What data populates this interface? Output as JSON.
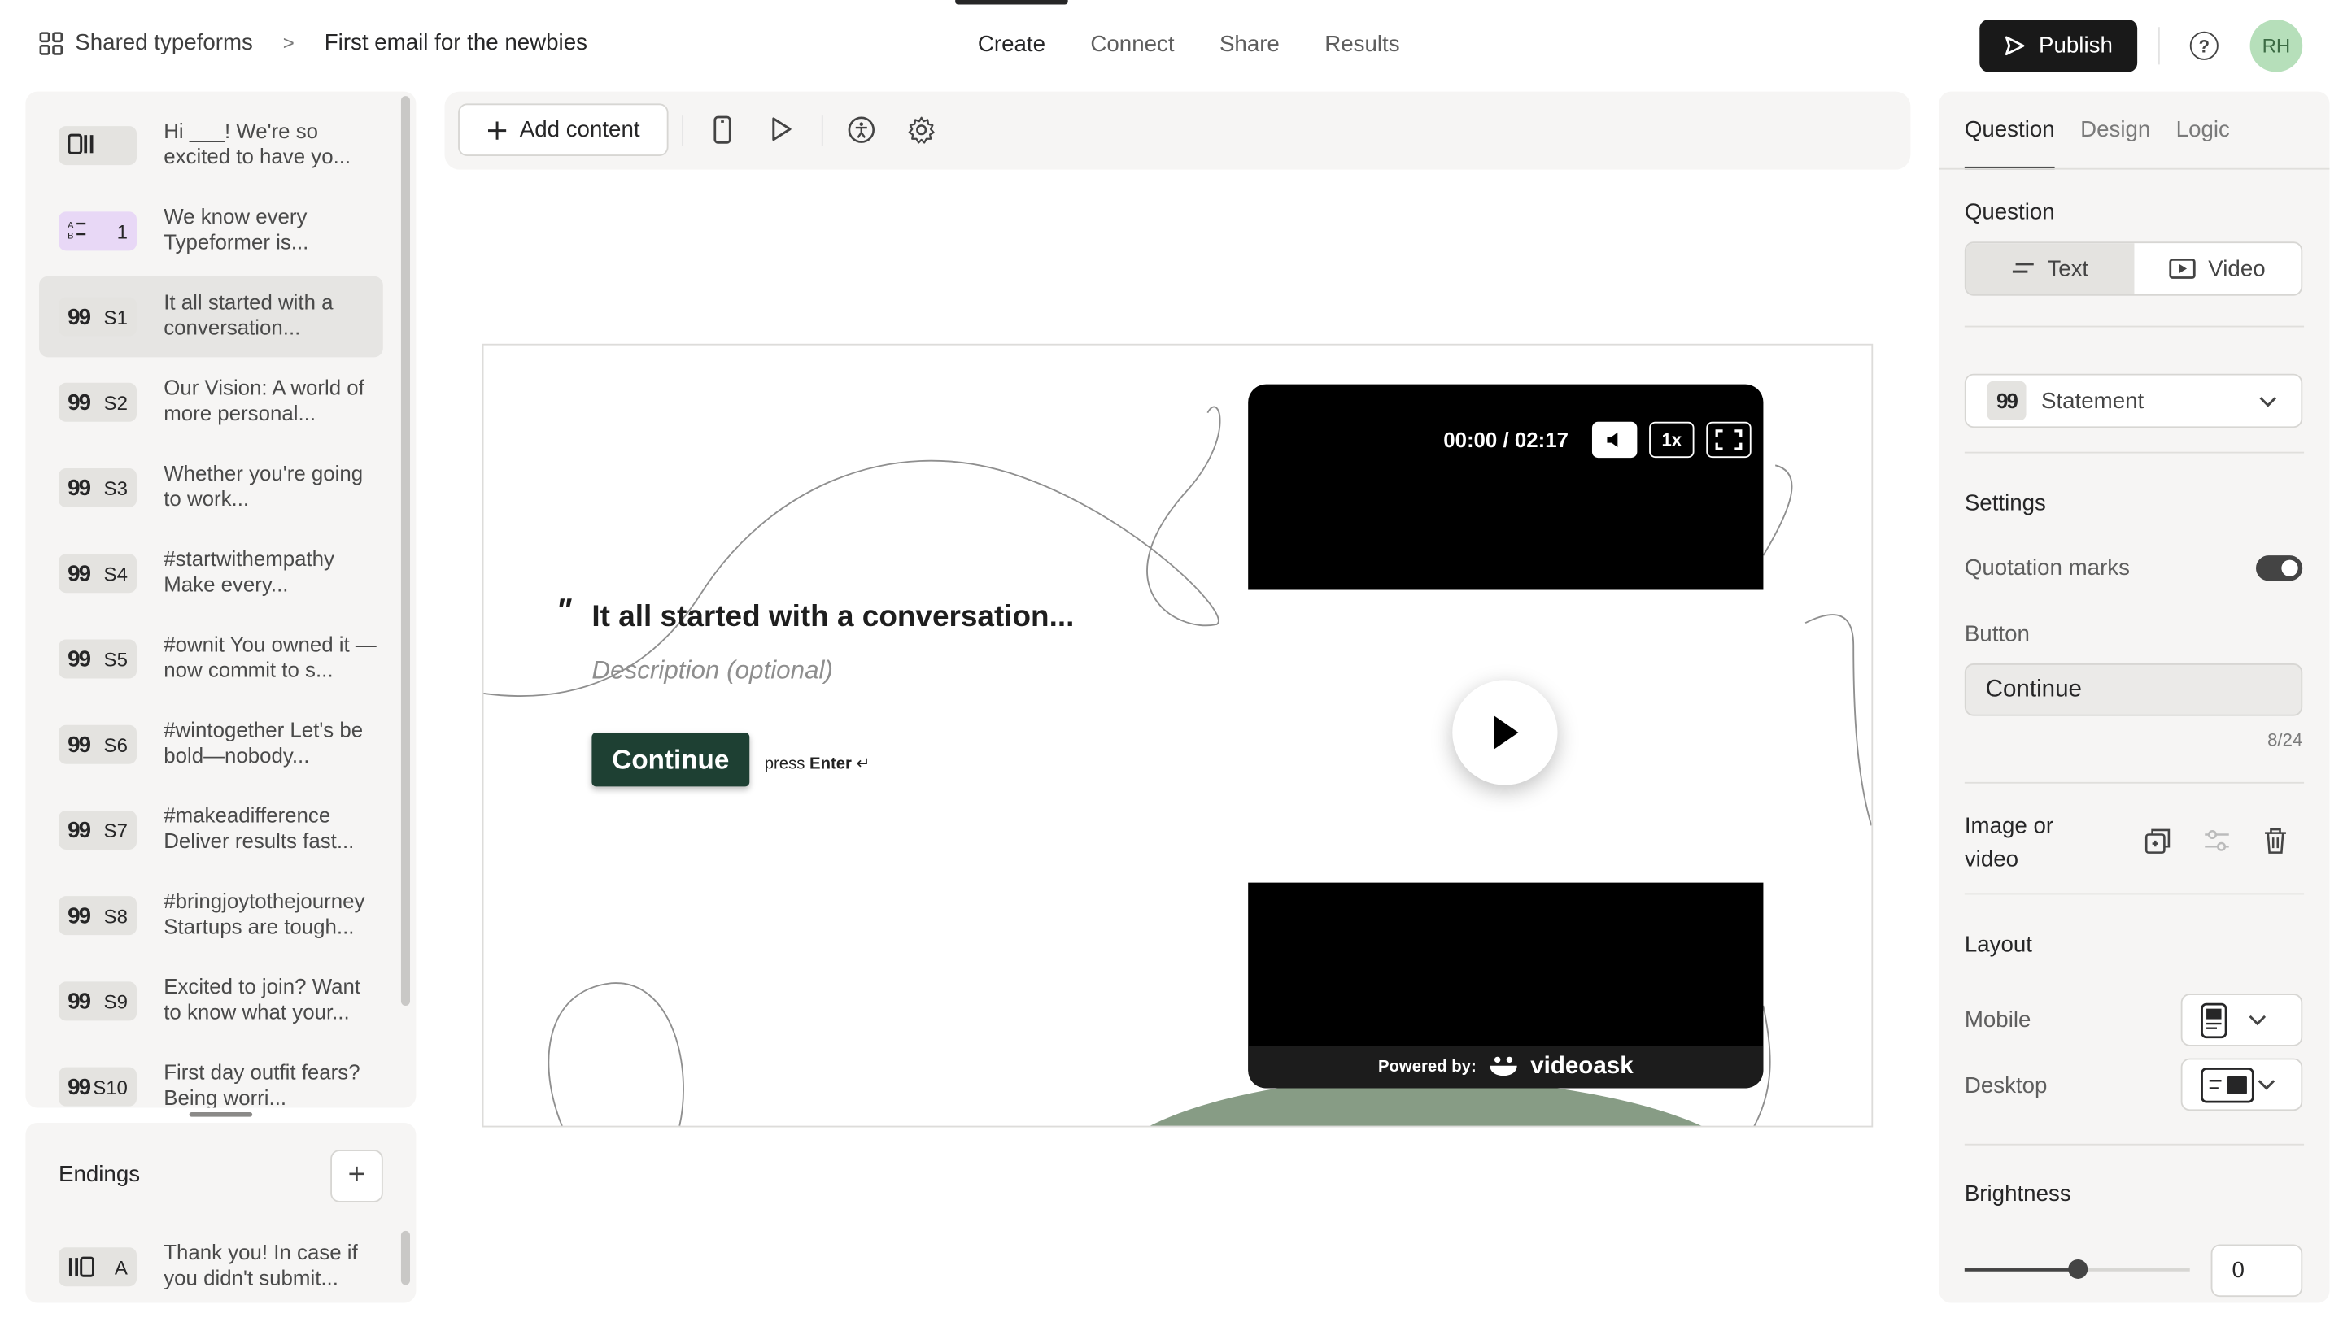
{
  "header": {
    "workspace": "Shared typeforms",
    "form_title": "First email for the newbies",
    "tabs": [
      "Create",
      "Connect",
      "Share",
      "Results"
    ],
    "active_tab": "Create",
    "publish_label": "Publish",
    "help_label": "?",
    "avatar_initials": "RH"
  },
  "questions": [
    {
      "badge": "",
      "text": "Hi ___! We're so excited to have yo...",
      "icon": "welcome-screen-icon"
    },
    {
      "badge": "1",
      "text": "We know every Typeformer is...",
      "icon": "ranking-icon"
    },
    {
      "badge": "S1",
      "text": "It all started with a conversation...",
      "icon": "statement-icon",
      "active": true
    },
    {
      "badge": "S2",
      "text": "Our Vision: A world of more personal...",
      "icon": "statement-icon"
    },
    {
      "badge": "S3",
      "text": "Whether you're going to work...",
      "icon": "statement-icon"
    },
    {
      "badge": "S4",
      "text": "#startwithempathy Make every...",
      "icon": "statement-icon"
    },
    {
      "badge": "S5",
      "text": "#ownit You owned it —now commit to s...",
      "icon": "statement-icon"
    },
    {
      "badge": "S6",
      "text": "#wintogether Let's be bold—nobody...",
      "icon": "statement-icon"
    },
    {
      "badge": "S7",
      "text": "#makeadifference Deliver results fast...",
      "icon": "statement-icon"
    },
    {
      "badge": "S8",
      "text": "#bringjoytothejourney Startups are tough...",
      "icon": "statement-icon"
    },
    {
      "badge": "S9",
      "text": "Excited to join? Want to know what your...",
      "icon": "statement-icon"
    },
    {
      "badge": "S10",
      "text": "First day outfit fears? Being worri...",
      "icon": "statement-icon"
    }
  ],
  "endings": {
    "title": "Endings",
    "add_label": "+",
    "items": [
      {
        "badge": "A",
        "text": "Thank you! In case if you didn't submit..."
      }
    ]
  },
  "toolbar": {
    "add_content_label": "Add content"
  },
  "canvas": {
    "statement_title": "It all started with a conversation...",
    "description_placeholder": "Description (optional)",
    "continue_label": "Continue",
    "press_label": "press",
    "enter_label": "Enter",
    "enter_symbol": "↵",
    "quote_mark": "\"",
    "video": {
      "time": "00:00 / 02:17",
      "speed": "1x",
      "powered_by": "Powered by:",
      "brand": "videoask"
    }
  },
  "right_panel": {
    "tabs": [
      "Question",
      "Design",
      "Logic"
    ],
    "active_tab": "Question",
    "question_section": "Question",
    "question_types": [
      "Text",
      "Video"
    ],
    "active_question_type": "Text",
    "type_select": "Statement",
    "settings_title": "Settings",
    "quotation_marks_label": "Quotation marks",
    "quotation_marks_on": true,
    "button_label": "Button",
    "button_value": "Continue",
    "button_counter": "8/24",
    "image_or_video_label_1": "Image or",
    "image_or_video_label_2": "video",
    "layout_title": "Layout",
    "mobile_label": "Mobile",
    "desktop_label": "Desktop",
    "brightness_title": "Brightness",
    "brightness_value": "0",
    "brightness_fraction": 0.5
  },
  "colors": {
    "publish_bg": "#191919",
    "continue_bg": "#1e4033",
    "avatar_bg": "#b6dfba",
    "ranking_badge_bg": "#e8d8f6"
  }
}
